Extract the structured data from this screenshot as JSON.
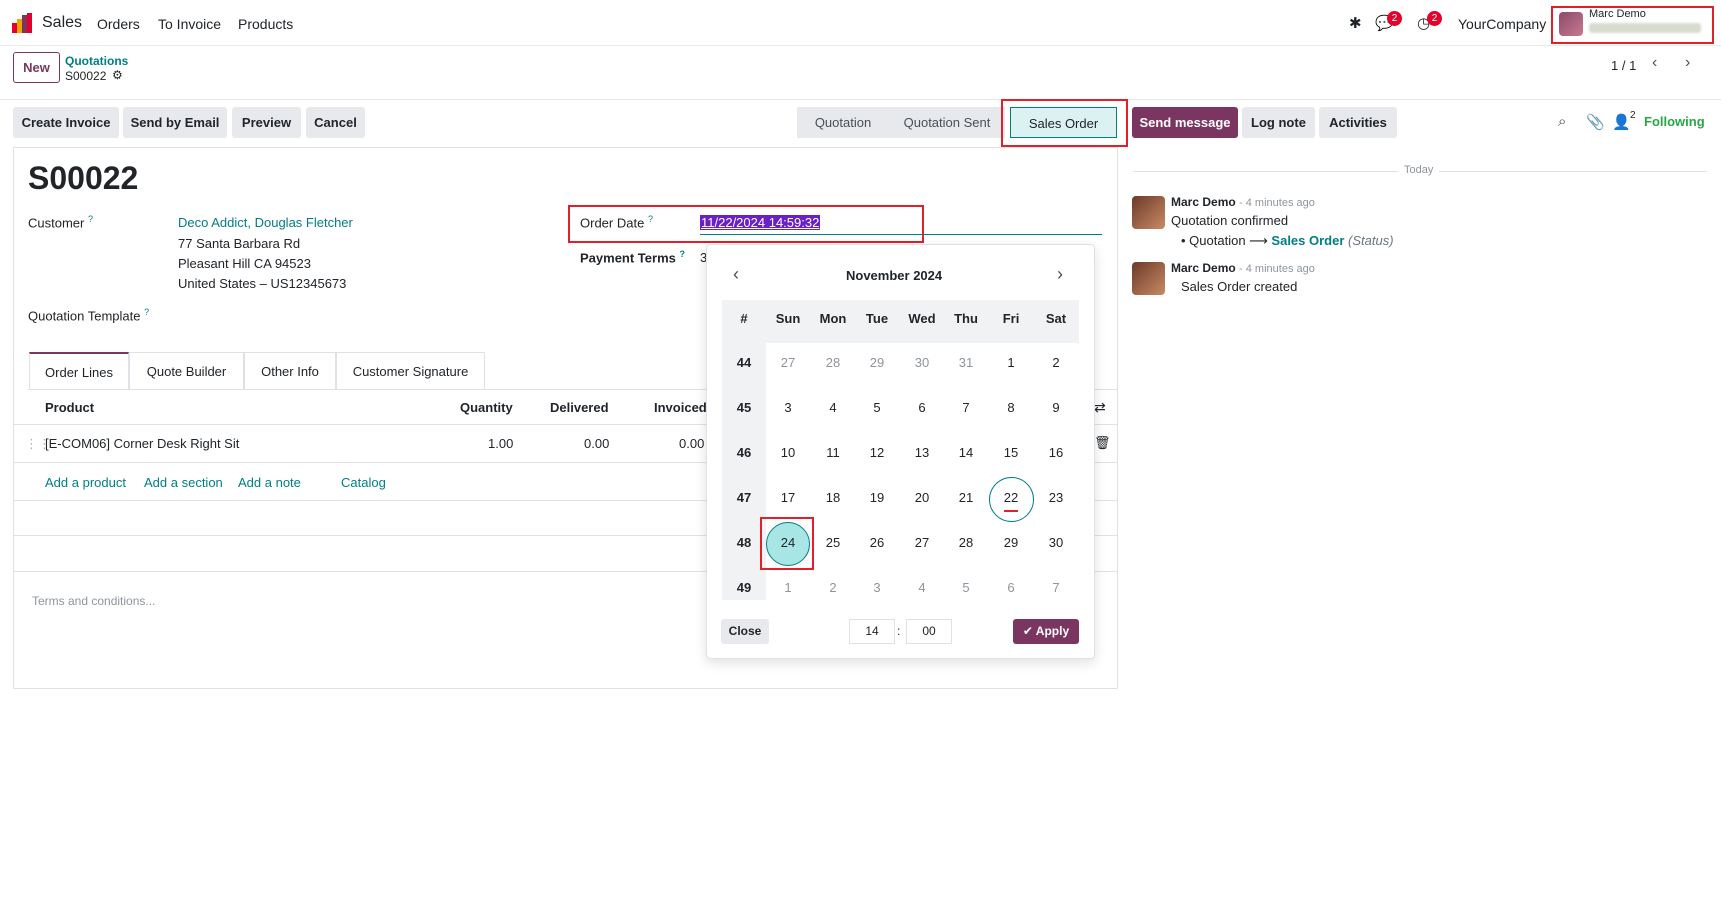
{
  "navbar": {
    "app_name": "Sales",
    "menu": [
      "Orders",
      "To Invoice",
      "Products"
    ],
    "messages_badge": "2",
    "activities_badge": "2",
    "company": "YourCompany",
    "user_name": "Marc Demo"
  },
  "control_panel": {
    "new_label": "New",
    "breadcrumb_parent": "Quotations",
    "breadcrumb_current": "S00022",
    "pager": "1 / 1"
  },
  "actions": [
    "Create Invoice",
    "Send by Email",
    "Preview",
    "Cancel"
  ],
  "statusbar": {
    "stages": [
      "Quotation",
      "Quotation Sent",
      "Sales Order"
    ],
    "active": "Sales Order"
  },
  "chatter_buttons": {
    "send_message": "Send message",
    "log_note": "Log note",
    "activities": "Activities",
    "followers_count": "2",
    "following": "Following"
  },
  "form": {
    "title": "S00022",
    "customer_label": "Customer",
    "customer_name": "Deco Addict, Douglas Fletcher",
    "address": [
      "77 Santa Barbara Rd",
      "Pleasant Hill CA 94523",
      "United States – US12345673"
    ],
    "template_label": "Quotation Template",
    "order_date_label": "Order Date",
    "order_date_value": "11/22/2024 14:59:32",
    "payment_terms_label": "Payment Terms",
    "payment_terms_value": "3",
    "help_mark": "?"
  },
  "tabs": [
    "Order Lines",
    "Quote Builder",
    "Other Info",
    "Customer Signature"
  ],
  "order_lines": {
    "headers": [
      "Product",
      "Quantity",
      "Delivered",
      "Invoiced"
    ],
    "rows": [
      {
        "product": "[E-COM06] Corner Desk Right Sit",
        "quantity": "1.00",
        "delivered": "0.00",
        "invoiced": "0.00"
      }
    ],
    "links": [
      "Add a product",
      "Add a section",
      "Add a note",
      "Catalog"
    ],
    "terms_placeholder": "Terms and conditions..."
  },
  "datepicker": {
    "month": "November 2024",
    "headers": [
      "#",
      "Sun",
      "Mon",
      "Tue",
      "Wed",
      "Thu",
      "Fri",
      "Sat"
    ],
    "weeks": [
      {
        "wk": "44",
        "days": [
          "27",
          "28",
          "29",
          "30",
          "31",
          "1",
          "2"
        ]
      },
      {
        "wk": "45",
        "days": [
          "3",
          "4",
          "5",
          "6",
          "7",
          "8",
          "9"
        ]
      },
      {
        "wk": "46",
        "days": [
          "10",
          "11",
          "12",
          "13",
          "14",
          "15",
          "16"
        ]
      },
      {
        "wk": "47",
        "days": [
          "17",
          "18",
          "19",
          "20",
          "21",
          "22",
          "23"
        ]
      },
      {
        "wk": "48",
        "days": [
          "24",
          "25",
          "26",
          "27",
          "28",
          "29",
          "30"
        ]
      },
      {
        "wk": "49",
        "days": [
          "1",
          "2",
          "3",
          "4",
          "5",
          "6",
          "7"
        ]
      }
    ],
    "today": "22",
    "selected": "24",
    "close_label": "Close",
    "hour": "14",
    "minute": "00",
    "apply_label": "Apply"
  },
  "chatter": {
    "date_separator": "Today",
    "messages": [
      {
        "author": "Marc Demo",
        "time": "- 4 minutes ago",
        "body": "Quotation confirmed",
        "tracking_old": "Quotation",
        "tracking_new": "Sales Order",
        "tracking_field": "(Status)"
      },
      {
        "author": "Marc Demo",
        "time": "- 4 minutes ago",
        "body": "Sales Order created"
      }
    ]
  },
  "colors": {
    "brand": "#7a3660",
    "link": "#017e84",
    "highlight_box": "#e0202a",
    "following": "#28a745"
  }
}
